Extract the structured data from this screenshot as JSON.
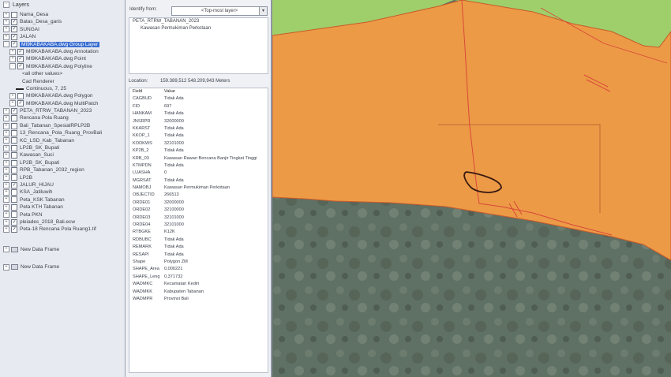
{
  "toc": {
    "title": "Layers",
    "items": [
      {
        "label": "Nama_Desa",
        "indent": 1,
        "expander": "+",
        "checked": false
      },
      {
        "label": "Batas_Desa_garis",
        "indent": 1,
        "expander": "+",
        "checked": true
      },
      {
        "label": "SUNGAI",
        "indent": 1,
        "expander": "+",
        "checked": true
      },
      {
        "label": "JALAN",
        "indent": 1,
        "expander": "+",
        "checked": true
      },
      {
        "label": "MI9KABAKABA.dwg Group Layer",
        "indent": 1,
        "expander": "-",
        "checked": true,
        "selected": true
      },
      {
        "label": "MI9KABAKABA.dwg Annotation",
        "indent": 2,
        "expander": "+",
        "checked": true
      },
      {
        "label": "MI9KABAKABA.dwg Point",
        "indent": 2,
        "expander": "+",
        "checked": true
      },
      {
        "label": "MI9KABAKABA.dwg Polyline",
        "indent": 2,
        "expander": "-",
        "checked": true
      },
      {
        "label": "<all other values>",
        "indent": 4
      },
      {
        "label": "Cad Renderer",
        "indent": 4
      },
      {
        "label": "Continuous, 7, 25",
        "indent": 3,
        "symbol": true
      },
      {
        "label": "MI9KABAKABA.dwg Polygon",
        "indent": 2,
        "expander": "+",
        "checked": false
      },
      {
        "label": "MI9KABAKABA.dwg MultiPatch",
        "indent": 2,
        "expander": "+",
        "checked": true
      },
      {
        "label": "PETA_RTRW_TABANAN_2023",
        "indent": 1,
        "expander": "+",
        "checked": true
      },
      {
        "label": "Rencana Pola Ruang",
        "indent": 1,
        "expander": "+",
        "checked": false
      },
      {
        "label": "Bali_Tabanan_SpesialRPLP2B",
        "indent": 1,
        "expander": "+",
        "checked": false
      },
      {
        "label": "13_Rencana_Pola_Ruang_ProvBali",
        "indent": 1,
        "expander": "+",
        "checked": false
      },
      {
        "label": "KC_LSD_Kab_Tabanan",
        "indent": 1,
        "expander": "+",
        "checked": false
      },
      {
        "label": "LP2B_SK_Bupati",
        "indent": 1,
        "expander": "+",
        "checked": false
      },
      {
        "label": "Kawasan_Suci",
        "indent": 1,
        "expander": "+",
        "checked": false
      },
      {
        "label": "LP2B_SK_Bupati",
        "indent": 1,
        "expander": "+",
        "checked": false
      },
      {
        "label": "RPB_Tabanan_2032_region",
        "indent": 1,
        "expander": "+",
        "checked": false
      },
      {
        "label": "LP2B",
        "indent": 1,
        "expander": "+",
        "checked": false
      },
      {
        "label": "JALUR_HIJAU",
        "indent": 1,
        "expander": "+",
        "checked": true
      },
      {
        "label": "KSA_Jatiluwih",
        "indent": 1,
        "expander": "+",
        "checked": false
      },
      {
        "label": "Peta_KSK Tabanan",
        "indent": 1,
        "expander": "+",
        "checked": false
      },
      {
        "label": "Peta KTH Tabanan",
        "indent": 1,
        "expander": "+",
        "checked": false
      },
      {
        "label": "Peta PKN",
        "indent": 1,
        "expander": "+",
        "checked": false
      },
      {
        "label": "pleiades_2018_Bali.ecw",
        "indent": 1,
        "expander": "+",
        "checked": true
      },
      {
        "label": "Peta-18 Rencana Pola Ruang1.tif",
        "indent": 1,
        "expander": "+",
        "checked": true
      }
    ],
    "frames": [
      "New Data Frame",
      "New Data Frame"
    ]
  },
  "identify": {
    "from_label": "Identify from:",
    "from_value": "<Top-most layer>",
    "dropdown_arrow": "▾",
    "tree_layer": "PETA_RTRW_TABANAN_2023",
    "tree_feature": "Kawasan Permukiman Perkotaan",
    "location_label": "Location:",
    "location_value": "159.389,512  548.209,943 Meters",
    "header": {
      "field": "Field",
      "value": "Value"
    },
    "fields": [
      {
        "field": "CAGBUD",
        "value": "Tidak Ada"
      },
      {
        "field": "FID",
        "value": "697"
      },
      {
        "field": "HANKAM",
        "value": "Tidak Ada"
      },
      {
        "field": "JNSRPR",
        "value": "32000000"
      },
      {
        "field": "KKARST",
        "value": "Tidak Ada"
      },
      {
        "field": "KKOP_1",
        "value": "Tidak Ada"
      },
      {
        "field": "KODKWS",
        "value": "32101000"
      },
      {
        "field": "KP2B_2",
        "value": "Tidak Ada"
      },
      {
        "field": "KRB_03",
        "value": "Kawasan Rawan Bencana Banjir Tingkat Tinggi"
      },
      {
        "field": "KTMPDN",
        "value": "Tidak Ada"
      },
      {
        "field": "LUASHA",
        "value": "0"
      },
      {
        "field": "MGRSAT",
        "value": "Tidak Ada"
      },
      {
        "field": "NAMOBJ",
        "value": "Kawasan Permukiman Perkotaan"
      },
      {
        "field": "OBJECTID",
        "value": "266513"
      },
      {
        "field": "ORDE01",
        "value": "32000000"
      },
      {
        "field": "ORDE02",
        "value": "32100000"
      },
      {
        "field": "ORDE03",
        "value": "32101000"
      },
      {
        "field": "ORDE04",
        "value": "32101000"
      },
      {
        "field": "RTBGKE",
        "value": "K12K"
      },
      {
        "field": "RDBUBC",
        "value": "Tidak Ada"
      },
      {
        "field": "REMARK",
        "value": "Tidak Ada"
      },
      {
        "field": "RESAPI",
        "value": "Tidak Ada"
      },
      {
        "field": "Shape",
        "value": "Polygon ZM"
      },
      {
        "field": "SHAPE_Area",
        "value": "0,000221"
      },
      {
        "field": "SHAPE_Leng",
        "value": "0,371732"
      },
      {
        "field": "WADMKC",
        "value": "Kecamatan Kediri"
      },
      {
        "field": "WADMKK",
        "value": "Kabupaten Tabanan"
      },
      {
        "field": "WADMPR",
        "value": "Provinsi Bali"
      }
    ]
  },
  "map": {
    "colors": {
      "zone": "#ec9a46",
      "zone_edge": "#c85a2a",
      "vegetation": "#9fcf6a",
      "imagery": "#5f7064",
      "cad_line": "#d9473a",
      "parcel": "#3a1a12"
    }
  }
}
